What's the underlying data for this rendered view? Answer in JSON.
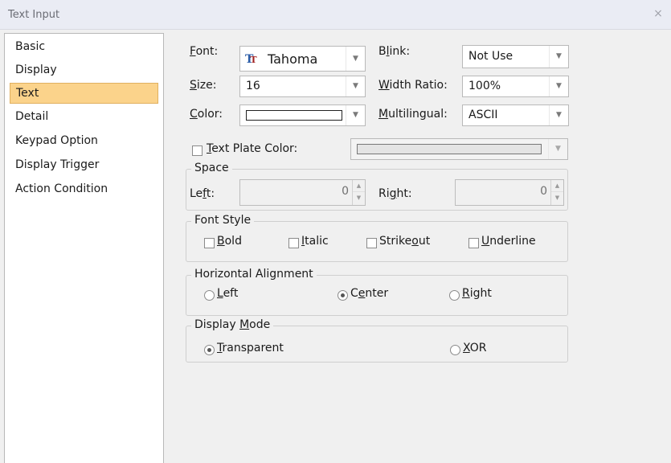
{
  "window": {
    "title": "Text Input",
    "close": "×"
  },
  "sidebar": {
    "items": [
      {
        "label": "Basic",
        "selected": false
      },
      {
        "label": "Display",
        "selected": false
      },
      {
        "label": "Text",
        "selected": true
      },
      {
        "label": "Detail",
        "selected": false
      },
      {
        "label": "Keypad Option",
        "selected": false
      },
      {
        "label": "Display Trigger",
        "selected": false
      },
      {
        "label": "Action Condition",
        "selected": false
      }
    ]
  },
  "text": {
    "font": {
      "label_pre": "",
      "label_key": "F",
      "label_post": "ont:",
      "value": "Tahoma",
      "glyph": "T"
    },
    "size": {
      "label_key": "S",
      "label_post": "ize:",
      "value": "16"
    },
    "color": {
      "label_key": "C",
      "label_post": "olor:",
      "swatch": "#ffffff"
    },
    "blink": {
      "label_pre": "B",
      "label_key": "l",
      "label_post": "ink:",
      "value": "Not Use"
    },
    "width_ratio": {
      "label_key": "W",
      "label_post": "idth Ratio:",
      "value": "100%"
    },
    "multilingual": {
      "label_key": "M",
      "label_post": "ultilingual:",
      "value": "ASCII"
    },
    "plate": {
      "label_key": "T",
      "label_post": "ext Plate Color:",
      "checked": false,
      "swatch": "#d8d8d8"
    }
  },
  "space": {
    "title": "Space",
    "left": {
      "label_pre": "Le",
      "label_key": "f",
      "label_post": "t:",
      "value": "0"
    },
    "right": {
      "label_pre": "Ri",
      "label_key": "g",
      "label_post": "ht:",
      "value": "0"
    }
  },
  "font_style": {
    "title": "Font Style",
    "bold": {
      "label_key": "B",
      "label_post": "old",
      "checked": false
    },
    "italic": {
      "label_key": "I",
      "label_post": "talic",
      "checked": false
    },
    "strikeout": {
      "label_pre": "Strike",
      "label_key": "o",
      "label_post": "ut",
      "checked": false
    },
    "underline": {
      "label_key": "U",
      "label_post": "nderline",
      "checked": false
    }
  },
  "halign": {
    "title": "Horizontal Alignment",
    "left": {
      "label_key": "L",
      "label_post": "eft",
      "selected": false
    },
    "center": {
      "label_pre": "C",
      "label_key": "e",
      "label_post": "nter",
      "selected": true
    },
    "right": {
      "label_key": "R",
      "label_post": "ight",
      "selected": false
    }
  },
  "display_mode": {
    "title_pre": "Display ",
    "title_key": "M",
    "title_post": "ode",
    "transparent": {
      "label_key": "T",
      "label_post": "ransparent",
      "selected": true
    },
    "xor": {
      "label_key": "X",
      "label_post": "OR",
      "selected": false
    }
  },
  "icons": {
    "dropdown": "chevron-down-icon",
    "spin_up": "spin-up-icon",
    "spin_down": "spin-down-icon",
    "font": "truetype-font-icon"
  }
}
